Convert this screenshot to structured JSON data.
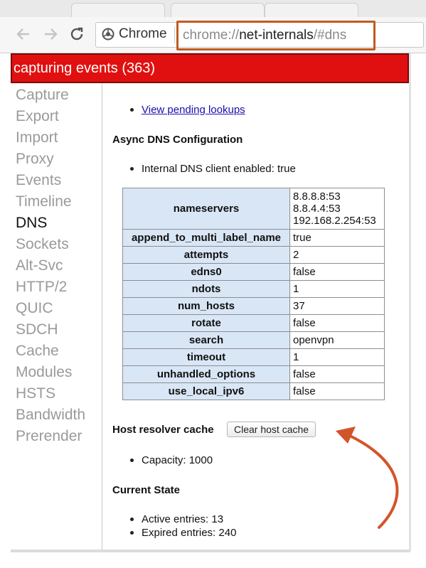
{
  "browser": {
    "chip_label": "Chrome",
    "url": {
      "scheme": "chrome://",
      "host": "net-internals",
      "hash": "/#dns"
    }
  },
  "status": {
    "text": "capturing events (363)",
    "color": "#e11010"
  },
  "sidebar": {
    "items": [
      {
        "label": "Capture"
      },
      {
        "label": "Export"
      },
      {
        "label": "Import"
      },
      {
        "label": "Proxy"
      },
      {
        "label": "Events"
      },
      {
        "label": "Timeline"
      },
      {
        "label": "DNS",
        "active": true
      },
      {
        "label": "Sockets"
      },
      {
        "label": "Alt-Svc"
      },
      {
        "label": "HTTP/2"
      },
      {
        "label": "QUIC"
      },
      {
        "label": "SDCH"
      },
      {
        "label": "Cache"
      },
      {
        "label": "Modules"
      },
      {
        "label": "HSTS"
      },
      {
        "label": "Bandwidth"
      },
      {
        "label": "Prerender"
      }
    ]
  },
  "dns": {
    "pending_link": "View pending lookups",
    "async_heading": "Async DNS Configuration",
    "internal_client": "Internal DNS client enabled: true",
    "config_rows": [
      {
        "key": "nameservers",
        "values": [
          "8.8.8.8:53",
          "8.8.4.4:53",
          "192.168.2.254:53"
        ]
      },
      {
        "key": "append_to_multi_label_name",
        "values": [
          "true"
        ]
      },
      {
        "key": "attempts",
        "values": [
          "2"
        ]
      },
      {
        "key": "edns0",
        "values": [
          "false"
        ]
      },
      {
        "key": "ndots",
        "values": [
          "1"
        ]
      },
      {
        "key": "num_hosts",
        "values": [
          "37"
        ]
      },
      {
        "key": "rotate",
        "values": [
          "false"
        ]
      },
      {
        "key": "search",
        "values": [
          "openvpn"
        ]
      },
      {
        "key": "timeout",
        "values": [
          "1"
        ]
      },
      {
        "key": "unhandled_options",
        "values": [
          "false"
        ]
      },
      {
        "key": "use_local_ipv6",
        "values": [
          "false"
        ]
      }
    ],
    "cache_heading": "Host resolver cache",
    "clear_button": "Clear host cache",
    "capacity": "Capacity: 1000",
    "state_heading": "Current State",
    "active_entries": "Active entries: 13",
    "expired_entries": "Expired entries: 240"
  },
  "colors": {
    "header_cell": "#d9e6f6",
    "highlight": "#bf5b20",
    "arrow": "#d2552a"
  }
}
